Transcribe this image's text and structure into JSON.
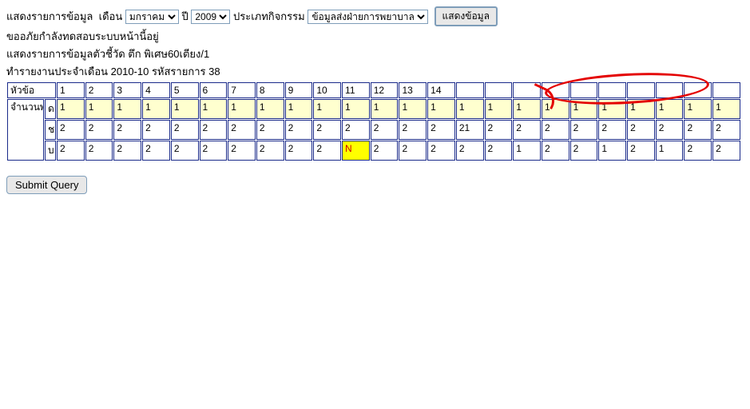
{
  "filter": {
    "label_show_list": "แสดงรายการข้อมูล",
    "label_month": "เดือน",
    "month_value": "มกราคม",
    "label_year": "ปี",
    "year_value": "2009",
    "label_activity": "ประเภทกิจกรรม",
    "activity_value": "ข้อมูลส่งฝ่ายการพยาบาล",
    "show_button": "แสดงข้อมูล"
  },
  "info": {
    "line1": "ขออภัยกำลังทดสอบระบบหน้านี้อยู่",
    "line2": "แสดงรายการข้อมูลตัวชี้วัด ตึก พิเศษ60เตียง/1",
    "line3": "ทำรายงานประจำเดือน 2010-10 รหัสรายการ 38"
  },
  "table": {
    "topic_header": "หัวข้อ",
    "col_headers": [
      "1",
      "2",
      "3",
      "4",
      "5",
      "6",
      "7",
      "8",
      "9",
      "10",
      "11",
      "12",
      "13",
      "14",
      "",
      "",
      "",
      "",
      "",
      "",
      "",
      "",
      "",
      ""
    ],
    "row_label": "จำนวนพยาบาลวิชาชีพในเวร (ไม่รวมหัวหน้าตึก)",
    "rows": [
      {
        "sub": "ด",
        "class": "row-d",
        "cells": [
          "1",
          "1",
          "1",
          "1",
          "1",
          "1",
          "1",
          "1",
          "1",
          "1",
          "1",
          "1",
          "1",
          "1",
          "1",
          "1",
          "1",
          "1",
          "1",
          "1",
          "1",
          "1",
          "1",
          "1"
        ]
      },
      {
        "sub": "ช",
        "class": "row-ch",
        "cells": [
          "2",
          "2",
          "2",
          "2",
          "2",
          "2",
          "2",
          "2",
          "2",
          "2",
          "2",
          "2",
          "2",
          "2",
          "21",
          "2",
          "2",
          "2",
          "2",
          "2",
          "2",
          "2",
          "2",
          "2"
        ]
      },
      {
        "sub": "บ",
        "class": "row-b",
        "cells": [
          "2",
          "2",
          "2",
          "2",
          "2",
          "2",
          "2",
          "2",
          "2",
          "2",
          {
            "v": "N",
            "hl": true
          },
          "2",
          "2",
          "2",
          "2",
          "2",
          "1",
          "2",
          "2",
          "1",
          "2",
          "1",
          "2",
          "2"
        ]
      }
    ]
  },
  "submit_label": "Submit Query"
}
